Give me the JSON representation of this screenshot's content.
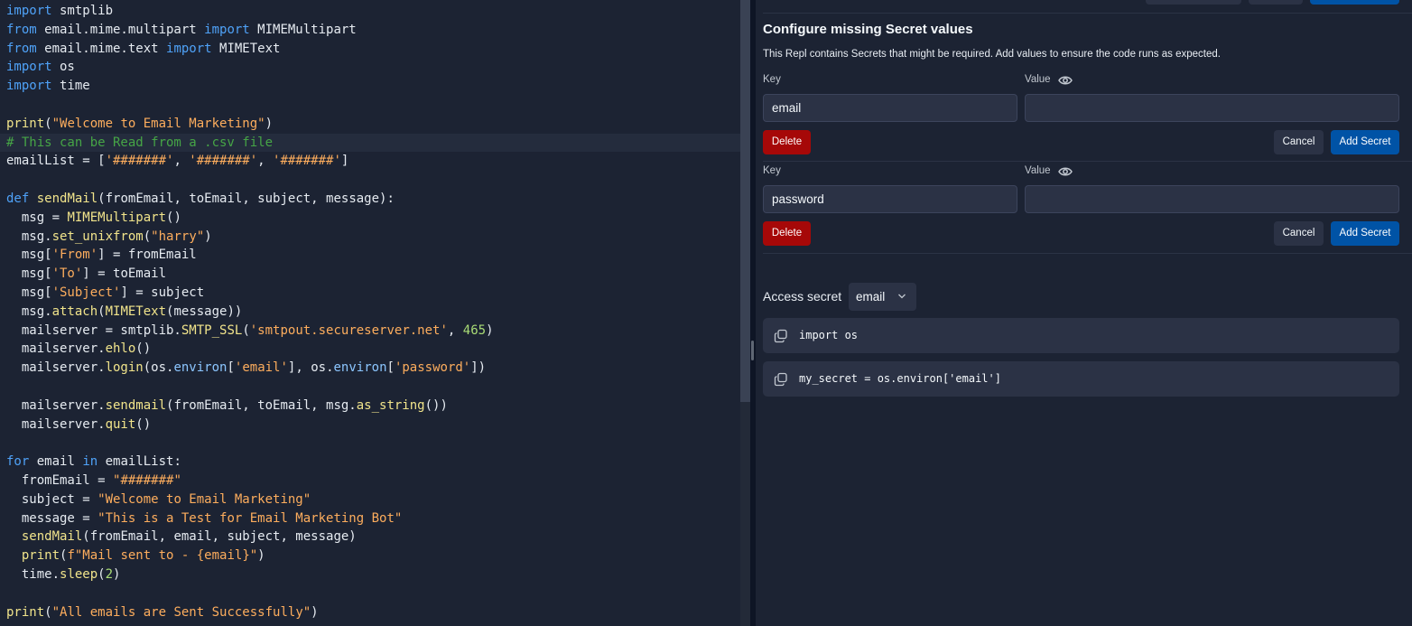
{
  "editor": {
    "lines": [
      [
        {
          "t": "import",
          "c": "kw"
        },
        {
          "t": " smtplib"
        }
      ],
      [
        {
          "t": "from",
          "c": "kw"
        },
        {
          "t": " email.mime.multipart "
        },
        {
          "t": "import",
          "c": "kw"
        },
        {
          "t": " MIMEMultipart"
        }
      ],
      [
        {
          "t": "from",
          "c": "kw"
        },
        {
          "t": " email.mime.text "
        },
        {
          "t": "import",
          "c": "kw"
        },
        {
          "t": " MIMEText"
        }
      ],
      [
        {
          "t": "import",
          "c": "kw"
        },
        {
          "t": " os"
        }
      ],
      [
        {
          "t": "import",
          "c": "kw"
        },
        {
          "t": " time"
        }
      ],
      [],
      [
        {
          "t": "print",
          "c": "fn"
        },
        {
          "t": "("
        },
        {
          "t": "\"Welcome to Email Marketing\"",
          "c": "str"
        },
        {
          "t": ")"
        }
      ],
      [
        {
          "t": "# This can be Read from a .csv file",
          "c": "com"
        }
      ],
      [
        {
          "t": "emailList = ["
        },
        {
          "t": "'#######'",
          "c": "str"
        },
        {
          "t": ", "
        },
        {
          "t": "'#######'",
          "c": "str"
        },
        {
          "t": ", "
        },
        {
          "t": "'#######'",
          "c": "str"
        },
        {
          "t": "]"
        }
      ],
      [],
      [
        {
          "t": "def",
          "c": "kw"
        },
        {
          "t": " "
        },
        {
          "t": "sendMail",
          "c": "fn"
        },
        {
          "t": "(fromEmail, toEmail, subject, message):"
        }
      ],
      [
        {
          "t": "  msg = "
        },
        {
          "t": "MIMEMultipart",
          "c": "fn"
        },
        {
          "t": "()"
        }
      ],
      [
        {
          "t": "  msg."
        },
        {
          "t": "set_unixfrom",
          "c": "fn"
        },
        {
          "t": "("
        },
        {
          "t": "\"harry\"",
          "c": "str"
        },
        {
          "t": ")"
        }
      ],
      [
        {
          "t": "  msg["
        },
        {
          "t": "'From'",
          "c": "str"
        },
        {
          "t": "] = fromEmail"
        }
      ],
      [
        {
          "t": "  msg["
        },
        {
          "t": "'To'",
          "c": "str"
        },
        {
          "t": "] = toEmail"
        }
      ],
      [
        {
          "t": "  msg["
        },
        {
          "t": "'Subject'",
          "c": "str"
        },
        {
          "t": "] = subject"
        }
      ],
      [
        {
          "t": "  msg."
        },
        {
          "t": "attach",
          "c": "fn"
        },
        {
          "t": "("
        },
        {
          "t": "MIMEText",
          "c": "fn"
        },
        {
          "t": "(message))"
        }
      ],
      [
        {
          "t": "  mailserver = smtplib."
        },
        {
          "t": "SMTP_SSL",
          "c": "fn"
        },
        {
          "t": "("
        },
        {
          "t": "'smtpout.secureserver.net'",
          "c": "str"
        },
        {
          "t": ", "
        },
        {
          "t": "465",
          "c": "num"
        },
        {
          "t": ")"
        }
      ],
      [
        {
          "t": "  mailserver."
        },
        {
          "t": "ehlo",
          "c": "fn"
        },
        {
          "t": "()"
        }
      ],
      [
        {
          "t": "  mailserver."
        },
        {
          "t": "login",
          "c": "fn"
        },
        {
          "t": "(os."
        },
        {
          "t": "environ",
          "c": "attr"
        },
        {
          "t": "["
        },
        {
          "t": "'email'",
          "c": "str"
        },
        {
          "t": "], os."
        },
        {
          "t": "environ",
          "c": "attr"
        },
        {
          "t": "["
        },
        {
          "t": "'password'",
          "c": "str"
        },
        {
          "t": "])"
        }
      ],
      [],
      [
        {
          "t": "  mailserver."
        },
        {
          "t": "sendmail",
          "c": "fn"
        },
        {
          "t": "(fromEmail, toEmail, msg."
        },
        {
          "t": "as_string",
          "c": "fn"
        },
        {
          "t": "())"
        }
      ],
      [
        {
          "t": "  mailserver."
        },
        {
          "t": "quit",
          "c": "fn"
        },
        {
          "t": "()"
        }
      ],
      [],
      [
        {
          "t": "for",
          "c": "kw"
        },
        {
          "t": " email "
        },
        {
          "t": "in",
          "c": "kw"
        },
        {
          "t": " emailList:"
        }
      ],
      [
        {
          "t": "  fromEmail = "
        },
        {
          "t": "\"#######\"",
          "c": "str"
        }
      ],
      [
        {
          "t": "  subject = "
        },
        {
          "t": "\"Welcome to Email Marketing\"",
          "c": "str"
        }
      ],
      [
        {
          "t": "  message = "
        },
        {
          "t": "\"This is a Test for Email Marketing Bot\"",
          "c": "str"
        }
      ],
      [
        {
          "t": "  "
        },
        {
          "t": "sendMail",
          "c": "fn"
        },
        {
          "t": "(fromEmail, email, subject, message)"
        }
      ],
      [
        {
          "t": "  "
        },
        {
          "t": "print",
          "c": "fn"
        },
        {
          "t": "("
        },
        {
          "t": "f\"Mail sent to - {email}\"",
          "c": "str"
        },
        {
          "t": ")"
        }
      ],
      [
        {
          "t": "  time."
        },
        {
          "t": "sleep",
          "c": "fn"
        },
        {
          "t": "("
        },
        {
          "t": "2",
          "c": "num"
        },
        {
          "t": ")"
        }
      ],
      [],
      [
        {
          "t": "print",
          "c": "fn"
        },
        {
          "t": "("
        },
        {
          "t": "\"All emails are Sent Successfully\"",
          "c": "str"
        },
        {
          "t": ")"
        }
      ]
    ],
    "active_line": 7
  },
  "secrets_panel": {
    "title": "Configure missing Secret values",
    "description": "This Repl contains Secrets that might be required. Add values to ensure the code runs as expected.",
    "secrets": [
      {
        "key_label": "Key",
        "value_label": "Value",
        "key": "email",
        "value": "",
        "delete_label": "Delete",
        "cancel_label": "Cancel",
        "add_label": "Add Secret"
      },
      {
        "key_label": "Key",
        "value_label": "Value",
        "key": "password",
        "value": "",
        "delete_label": "Delete",
        "cancel_label": "Cancel",
        "add_label": "Add Secret"
      }
    ],
    "access": {
      "label": "Access secret",
      "selected": "email",
      "snippets": [
        "import os",
        "my_secret = os.environ['email']"
      ]
    }
  },
  "colors": {
    "background": "#1c2333",
    "field": "#2b3245",
    "delete": "#a60808",
    "primary": "#0053a6"
  },
  "icons": [
    "eye-icon",
    "chevron-down-icon",
    "copy-icon"
  ]
}
